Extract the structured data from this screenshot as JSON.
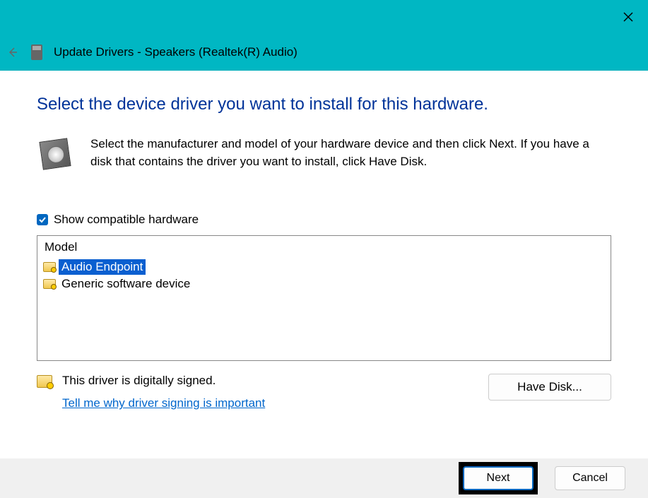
{
  "titlebar": {},
  "subheader": {
    "title": "Update Drivers - Speakers (Realtek(R) Audio)"
  },
  "heading": "Select the device driver you want to install for this hardware.",
  "instruction": "Select the manufacturer and model of your hardware device and then click Next. If you have a disk that contains the driver you want to install, click Have Disk.",
  "checkbox": {
    "label": "Show compatible hardware",
    "checked": true
  },
  "list": {
    "header": "Model",
    "items": [
      {
        "label": "Audio Endpoint",
        "selected": true
      },
      {
        "label": "Generic software device",
        "selected": false
      }
    ]
  },
  "signing": {
    "status": "This driver is digitally signed.",
    "link": "Tell me why driver signing is important"
  },
  "buttons": {
    "have_disk": "Have Disk...",
    "next": "Next",
    "cancel": "Cancel"
  }
}
